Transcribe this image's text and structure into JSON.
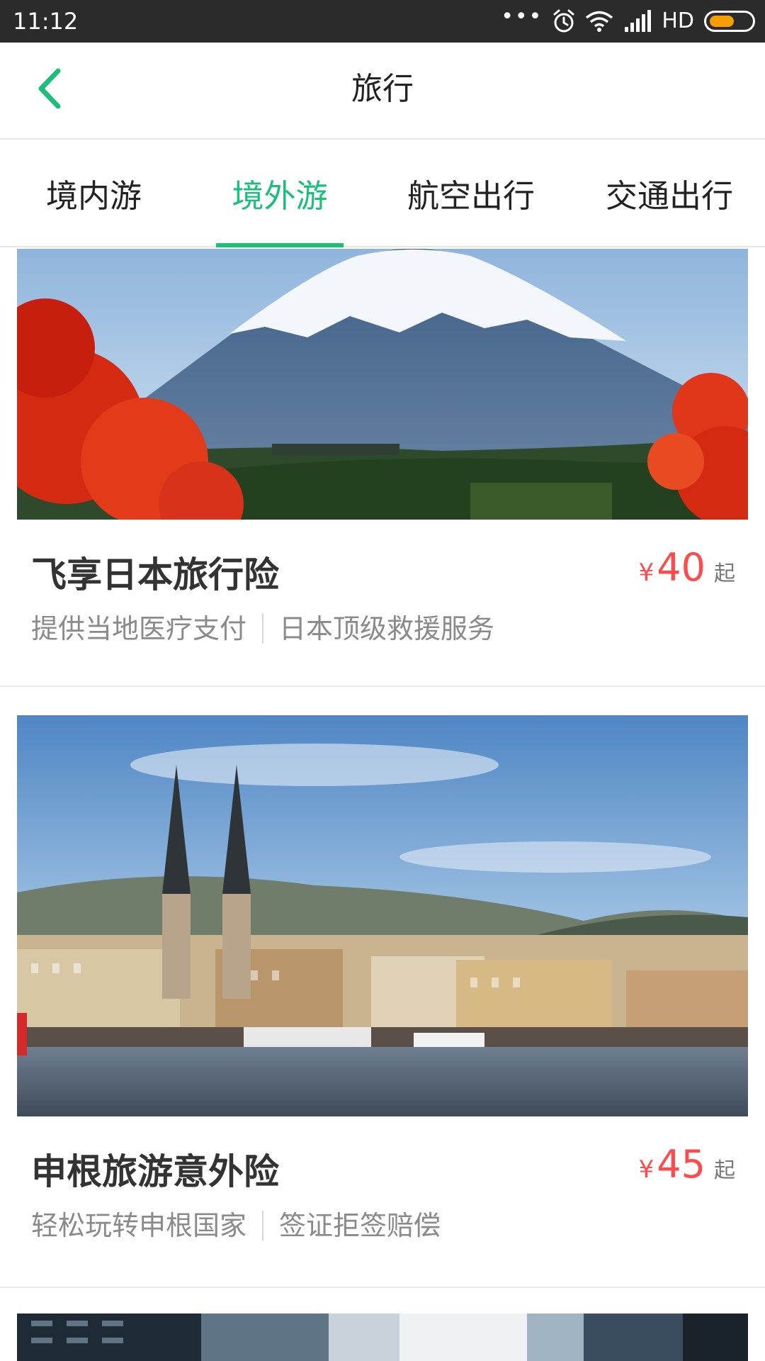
{
  "status_bar": {
    "time": "11:12",
    "dots": "•••",
    "network": "HD",
    "battery_level": 0.6,
    "icons": [
      "alarm-icon",
      "wifi-icon",
      "signal-icon",
      "battery-icon"
    ]
  },
  "header": {
    "title": "旅行",
    "back_icon": "chevron-left-icon"
  },
  "tabs": [
    {
      "label": "境内游",
      "active": false
    },
    {
      "label": "境外游",
      "active": true
    },
    {
      "label": "航空出行",
      "active": false
    },
    {
      "label": "交通出行",
      "active": false
    }
  ],
  "products": [
    {
      "title": "飞享日本旅行险",
      "price_symbol": "¥",
      "price": "40",
      "price_suffix": "起",
      "features": [
        "提供当地医疗支付",
        "日本顶级救援服务"
      ],
      "image": "mount-fuji-photo"
    },
    {
      "title": "申根旅游意外险",
      "price_symbol": "¥",
      "price": "45",
      "price_suffix": "起",
      "features": [
        "轻松玩转申根国家",
        "签证拒签赔偿"
      ],
      "image": "lucerne-city-photo"
    },
    {
      "image": "city-buildings-photo"
    }
  ],
  "colors": {
    "accent": "#1bbf7a",
    "price": "#ff4b4b",
    "status_bar": "#2b2b2b",
    "battery": "#f5a000"
  }
}
